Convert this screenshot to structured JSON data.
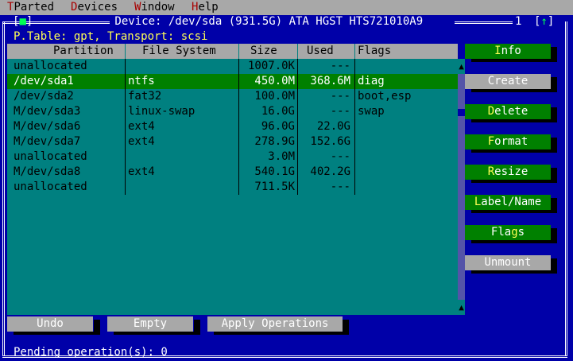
{
  "menubar": {
    "items": [
      {
        "hot": "T",
        "rest": "Parted"
      },
      {
        "hot": "D",
        "rest": "evices"
      },
      {
        "hot": "W",
        "rest": "indow"
      },
      {
        "hot": "H",
        "rest": "elp"
      }
    ]
  },
  "window": {
    "close_box": "[■]",
    "title": " Device: /dev/sda (931.5G) ATA HGST HTS721010A9 ",
    "window_number": "1",
    "arrow_box": "[↑]",
    "subtitle": "P.Table: gpt, Transport: scsi"
  },
  "table": {
    "columns": [
      "Partition",
      "File System",
      "Size",
      "Used",
      "Flags"
    ],
    "rows": [
      {
        "partition": "unallocated",
        "fs": "",
        "size": "1007.0K",
        "used": "---",
        "flags": ""
      },
      {
        "partition": "/dev/sda1",
        "fs": "ntfs",
        "size": "450.0M",
        "used": "368.6M",
        "flags": "diag"
      },
      {
        "partition": "/dev/sda2",
        "fs": "fat32",
        "size": "100.0M",
        "used": "---",
        "flags": "boot,esp"
      },
      {
        "partition": "M/dev/sda3",
        "fs": "linux-swap",
        "size": "16.0G",
        "used": "---",
        "flags": "swap"
      },
      {
        "partition": "M/dev/sda6",
        "fs": "ext4",
        "size": "96.0G",
        "used": "22.0G",
        "flags": ""
      },
      {
        "partition": "M/dev/sda7",
        "fs": "ext4",
        "size": "278.9G",
        "used": "152.6G",
        "flags": ""
      },
      {
        "partition": "unallocated",
        "fs": "",
        "size": "3.0M",
        "used": "---",
        "flags": ""
      },
      {
        "partition": "M/dev/sda8",
        "fs": "ext4",
        "size": "540.1G",
        "used": "402.2G",
        "flags": ""
      },
      {
        "partition": "unallocated",
        "fs": "",
        "size": "711.5K",
        "used": "---",
        "flags": ""
      }
    ],
    "selected_index": 1
  },
  "scrollbar": {
    "up": "▲",
    "down": "▲"
  },
  "side_buttons": [
    {
      "pre": "",
      "hot": "I",
      "post": "nfo",
      "enabled": true
    },
    {
      "pre": "Create",
      "hot": "",
      "post": "",
      "enabled": false
    },
    {
      "pre": "",
      "hot": "D",
      "post": "elete",
      "enabled": true
    },
    {
      "pre": "",
      "hot": "F",
      "post": "ormat",
      "enabled": true
    },
    {
      "pre": "",
      "hot": "R",
      "post": "esize",
      "enabled": true
    },
    {
      "pre": "",
      "hot": "L",
      "post": "abel/Name",
      "enabled": true
    },
    {
      "pre": "Fla",
      "hot": "g",
      "post": "s",
      "enabled": true
    },
    {
      "pre": "Unmount",
      "hot": "",
      "post": "",
      "enabled": false
    }
  ],
  "bottom_buttons": [
    "Undo",
    "Empty",
    "Apply Operations"
  ],
  "status": {
    "pending": "Pending operation(s): 0"
  }
}
